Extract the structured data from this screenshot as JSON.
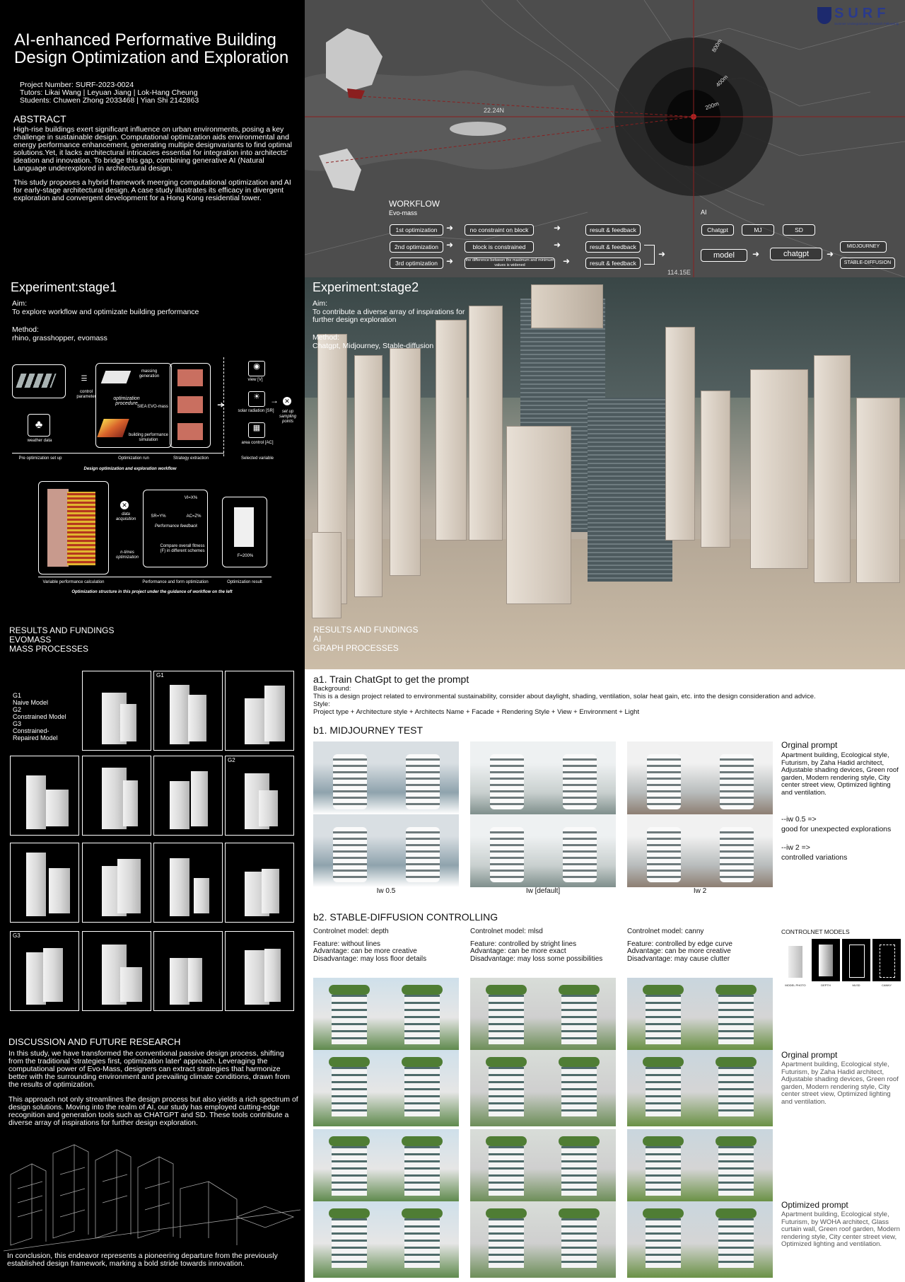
{
  "header": {
    "title_line1": "AI-enhanced Performative Building",
    "title_line2": "Design Optimization and Exploration",
    "project_number": "Project Number: SURF-2023-0024",
    "tutors": "Tutors: Likai Wang | Leyuan Jiang | Lok-Hang Cheung",
    "students": "Students: Chuwen Zhong 2033468 | Yian Shi 2142863"
  },
  "abstract": {
    "heading": "ABSTRACT",
    "para1": "High-rise buildings exert significant influence on urban environments, posing a key challenge in sustainable design. Computational optimization aids environmental and energy performance enhancement, generating multiple designvariants to find optimal solutions.Yet, it lacks architectural intricacies essential for integration into architects' ideation and innovation. To bridge this gap, combining generative AI (Natural Language underexplored in architectural design.",
    "para2": "This study proposes a hybrid framework meerging computational optimization and AI for early-stage architectural design. A case study illustrates its efficacy in divergent exploration and convergent development  for a Hong Kong residential tower."
  },
  "logo": {
    "text": "SURF",
    "subtext": "Summer Undergraduate Research Fellowship"
  },
  "map": {
    "lat_label": "22.24N",
    "lon_label": "114.15E",
    "ring_labels": [
      "800m",
      "400m",
      "200m"
    ]
  },
  "workflow": {
    "title": "WORKFLOW",
    "subtitle": "Evo-mass",
    "ai_label": "AI",
    "rows": [
      {
        "step": "1st optimization",
        "condition": "no constraint on block",
        "result": "result & feedback"
      },
      {
        "step": "2nd optimization",
        "condition": "block is constrained",
        "result": "result & feedback"
      },
      {
        "step": "3rd optimization",
        "condition": "the difference between the maximum and minimum values is widened",
        "result": "result & feedback"
      }
    ],
    "ai_tools": [
      "Chatgpt",
      "MJ",
      "SD"
    ],
    "model": "model",
    "chatgpt": "chatgpt",
    "outputs": [
      "MIDJOURNEY",
      "STABLE-DIFFUSION"
    ]
  },
  "stage1": {
    "heading": "Experiment:stage1",
    "aim_label": "Aim:",
    "aim": "To explore workflow and optimizate building performance",
    "method_label": "Method:",
    "method": "rhino, grasshopper, evomass",
    "diagram": {
      "control_parameter": "control parameter",
      "weather_data": "weather data",
      "massing_generation": "massing generation",
      "optimization_procedure": "optimization procedure",
      "siea": "SIEA EVO-mass",
      "building_sim": "building performance simulation",
      "view": "view [V]",
      "solar": "solar radiation [SR]",
      "area": "area control [AC]",
      "sampling": "set up sampling points",
      "pre_setup": "Pre optimization set up",
      "opt_run": "Optimization run",
      "strategy": "Strategy extraction",
      "selected": "Selected variable",
      "caption1": "Design optimization and exploration workflow",
      "data_acq": "data acquisition",
      "vis": "VI=X%",
      "sr": "SR=Y%",
      "ac": "AC=Z%",
      "perf_feedback": "Performance feedback",
      "compare": "Compare overall fitness (F) in different schemes",
      "ntimes": "n-times optimization",
      "fitness": "F=200%",
      "var_calc": "Variable performance calculation",
      "perf_form": "Performance and form optimization",
      "opt_result": "Optimization result",
      "caption2": "Optimization structure in this project under the guidance of workflow on the left"
    }
  },
  "stage2": {
    "heading": "Experiment:stage2",
    "aim_label": "Aim:",
    "aim": "To contribute a diverse array of inspirations for further design exploration",
    "method_label": "Method:",
    "method": "Chatgpt, Midjourney, Stable-diffusion"
  },
  "results_left": {
    "line1": "RESULTS AND FUNDINGS",
    "line2": "EVOMASS",
    "line3": "MASS PROCESSES",
    "legend": [
      {
        "code": "G1",
        "name": "Naive Model"
      },
      {
        "code": "G2",
        "name": "Constrained Model"
      },
      {
        "code": "G3",
        "name": "Constrained-Repaired Model"
      }
    ],
    "tags": [
      "G1",
      "G2",
      "G3"
    ]
  },
  "results_right": {
    "line1": "RESULTS AND FUNDINGS",
    "line2": "AI",
    "line3": "GRAPH PROCESSES"
  },
  "a1": {
    "heading": "a1. Train ChatGpt to get the prompt",
    "background_label": "Background:",
    "background": "This is a design project related to environmental sustainability, consider about daylight, shading, ventilation, solar heat gain, etc. into the design consideration and advice.",
    "style_label": "Style:",
    "style": "Project type + Architecture style + Architects Name + Facade + Rendering Style + View + Environment + Light"
  },
  "b1": {
    "heading": "b1. MIDJOURNEY TEST",
    "captions": [
      "Iw 0.5",
      "Iw [default]",
      "Iw 2"
    ],
    "prompt_heading": "Orginal prompt",
    "prompt": "Apartment building, Ecological style, Futurism, by Zaha Hadid architect, Adjustable shading devices, Green roof garden, Modern rendering style, City center street view, Optimized lighting and ventilation.",
    "iw05": "--iw 0.5 =>",
    "iw05_note": "good for unexpected explorations",
    "iw2": "--iw 2 =>",
    "iw2_note": "controlled variations"
  },
  "b2": {
    "heading": "b2. STABLE-DIFFUSION CONTROLLING",
    "models": [
      {
        "name": "Controlnet model: depth",
        "feature": "Feature: without lines",
        "adv": "Advantage: can be more creative",
        "dis": "Disadvantage: may loss floor details"
      },
      {
        "name": "Controlnet model: mlsd",
        "feature": "Feature: controlled by stright lines",
        "adv": "Advantage: can be more exact",
        "dis": "Disadvantage: may loss some possibilities"
      },
      {
        "name": "Controlnet model: canny",
        "feature": "Feature: controlled by edge curve",
        "adv": "Advantage: can be more creative",
        "dis": "Disadvantage: may cause clutter"
      }
    ],
    "controlnet_title": "CONTROLNET MODELS",
    "controlnet_labels": [
      "MODEL PHOTO",
      "DEPTH",
      "MLSD",
      "CANNY"
    ],
    "orig_heading": "Orginal prompt",
    "orig_prompt": "Apartment building, Ecological style, Futurism, by Zaha Hadid architect, Adjustable shading devices, Green roof garden, Modern rendering style, City center street view, Optimized lighting and ventilation.",
    "opt_heading": "Optimized prompt",
    "opt_prompt": "Apartment building, Ecological style, Futurism, by WOHA architect, Glass curtain wall, Green roof garden, Modern rendering style, City center street view, Optimized lighting and ventilation."
  },
  "discussion": {
    "heading": "DISCUSSION AND FUTURE RESEARCH",
    "para1": "In this study, we have transformed the conventional passive design process, shifting from the traditional 'strategies first, optimization later' approach. Leveraging the computational power of Evo-Mass, designers can extract strategies that harmonize better with the surrounding environment and prevailing climate conditions, drawn from the results of optimization.",
    "para2": "This approach not only streamlines the design process but also yields a rich spectrum of design solutions. Moving into the realm of AI, our study has employed cutting-edge recognition and generation tools such as CHATGPT and SD.  These tools contribute a diverse array of inspirations for further design exploration.",
    "conclusion": "In conclusion, this endeavor represents a pioneering departure from the previously established design framework, marking a bold stride towards innovation."
  }
}
